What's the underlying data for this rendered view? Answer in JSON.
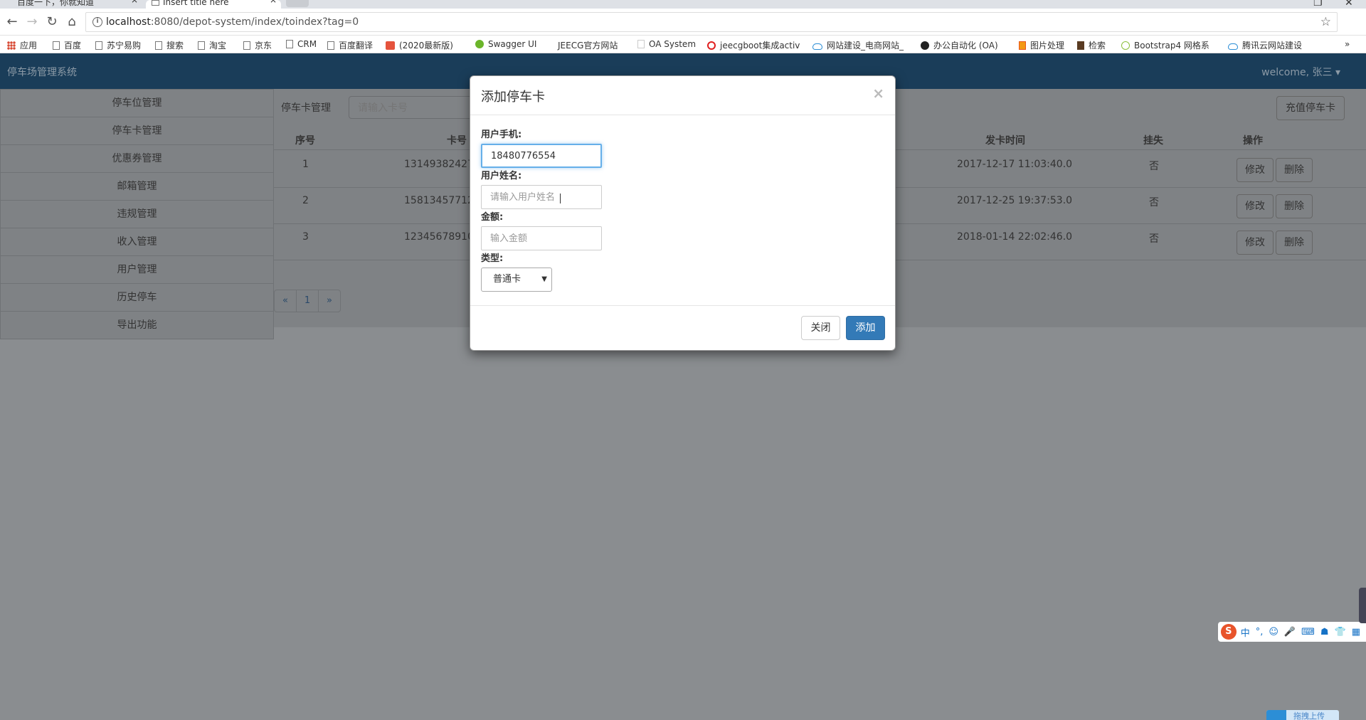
{
  "browser": {
    "tabs": [
      {
        "label": "百度一下，你就知道"
      },
      {
        "label": "Insert title here"
      }
    ],
    "url_host": "localhost",
    "url_path": ":8080/depot-system/index/toindex?tag=0",
    "bookmarks": [
      "应用",
      "百度",
      "苏宁易购",
      "搜索",
      "淘宝",
      "京东",
      "CRM",
      "百度翻译",
      "(2020最新版)",
      "Swagger UI",
      "JEECG官方网站",
      "OA System",
      "jeecgboot集成activ",
      "网站建设_电商网站_",
      "办公自动化 (OA)",
      "图片处理",
      "检索",
      "Bootstrap4 网格系",
      "腾讯云网站建设"
    ]
  },
  "app": {
    "brand": "停车场管理系统",
    "welcome": "welcome, 张三 ▾",
    "sidebar": [
      "停车位管理",
      "停车卡管理",
      "优惠券管理",
      "邮箱管理",
      "违规管理",
      "收入管理",
      "用户管理",
      "历史停车",
      "导出功能"
    ],
    "content": {
      "title": "停车卡管理",
      "search_placeholder": "请输入卡号",
      "recharge_label": "充值停车卡",
      "headers": {
        "index": "序号",
        "card": "卡号",
        "issue_time": "发卡时间",
        "lost": "挂失",
        "ops": "操作"
      },
      "rows": [
        {
          "index": "1",
          "card": "131493824272",
          "issue_time": "2017-12-17 11:03:40.0",
          "lost": "否"
        },
        {
          "index": "2",
          "card": "158134577122",
          "issue_time": "2017-12-25 19:37:53.0",
          "lost": "否"
        },
        {
          "index": "3",
          "card": "123456789102",
          "issue_time": "2018-01-14 22:02:46.0",
          "lost": "否"
        }
      ],
      "edit_label": "修改",
      "delete_label": "删除",
      "pagination": [
        "«",
        "1",
        "»"
      ]
    }
  },
  "modal": {
    "title": "添加停车卡",
    "close_x": "×",
    "phone_label": "用户手机:",
    "phone_value": "18480776554",
    "name_label": "用户姓名:",
    "name_placeholder": "请输入用户姓名",
    "amount_label": "金额:",
    "amount_placeholder": "输入金额",
    "type_label": "类型:",
    "type_value": "普通卡",
    "close_label": "关闭",
    "add_label": "添加"
  },
  "ime": {
    "lang": "中",
    "punct": "°,"
  },
  "upload": "拖拽上传"
}
